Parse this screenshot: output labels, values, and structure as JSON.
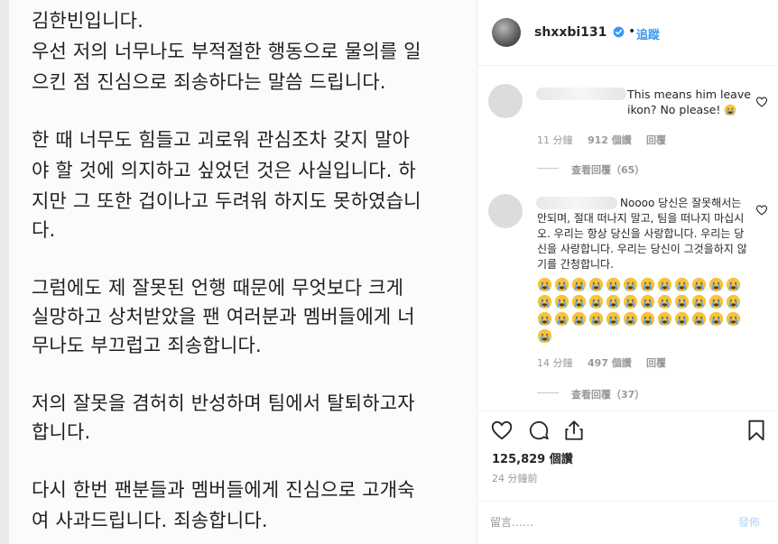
{
  "post": {
    "lines": [
      "김한빈입니다.",
      "우선 저의 너무나도 부적절한 행동으로 물의를 일",
      "으킨 점 진심으로 죄송하다는 말씀 드립니다.",
      "",
      "한 때 너무도 힘들고 괴로워 관심조차 갖지 말아",
      "야 할 것에 의지하고 싶었던 것은 사실입니다. 하",
      "지만 그 또한 겁이나고 두려워 하지도 못하였습니",
      "다.",
      "",
      "그럼에도 제 잘못된 언행 때문에 무엇보다 크게",
      "실망하고 상처받았을 팬 여러분과 멤버들에게 너",
      "무나도 부끄럽고 죄송합니다.",
      "",
      "저의 잘못을 겸허히 반성하며 팀에서 탈퇴하고자",
      "합니다.",
      "",
      "다시 한번 팬분들과 멤버들에게 진심으로 고개숙",
      "여 사과드립니다. 죄송합니다."
    ]
  },
  "header": {
    "username": "shxxbi131",
    "separator": "•",
    "follow_label": "追蹤",
    "verified_icon": "verified-badge-icon",
    "accent_color": "#3897f0"
  },
  "comments": [
    {
      "text": "This means him leave ikon? No please!",
      "emoji": "crying-face",
      "time": "11 分鐘",
      "likes": "912 個讚",
      "reply": "回覆",
      "view_replies": "查看回覆（65）"
    },
    {
      "text": "Noooo 당신은 잘못해서는 안되며, 절대 떠나지 말고, 팀을 떠나지 마십시오. 우리는 항상 당신을 사랑합니다. 우리는 당신을 사랑합니다. 우리는 당신이 그것을하지 않기를 간청합니다.",
      "emoji": "crying-face",
      "emoji_count": 37,
      "time": "14 分鐘",
      "likes": "497 個讚",
      "reply": "回覆",
      "view_replies": "查看回覆（37）"
    }
  ],
  "actions": {
    "icons": [
      "heart-icon",
      "comment-icon",
      "share-icon",
      "bookmark-icon"
    ],
    "likes": "125,829 個讚",
    "time_ago": "24 分鐘前"
  },
  "comment_box": {
    "placeholder": "留言……",
    "post_label": "發佈"
  }
}
